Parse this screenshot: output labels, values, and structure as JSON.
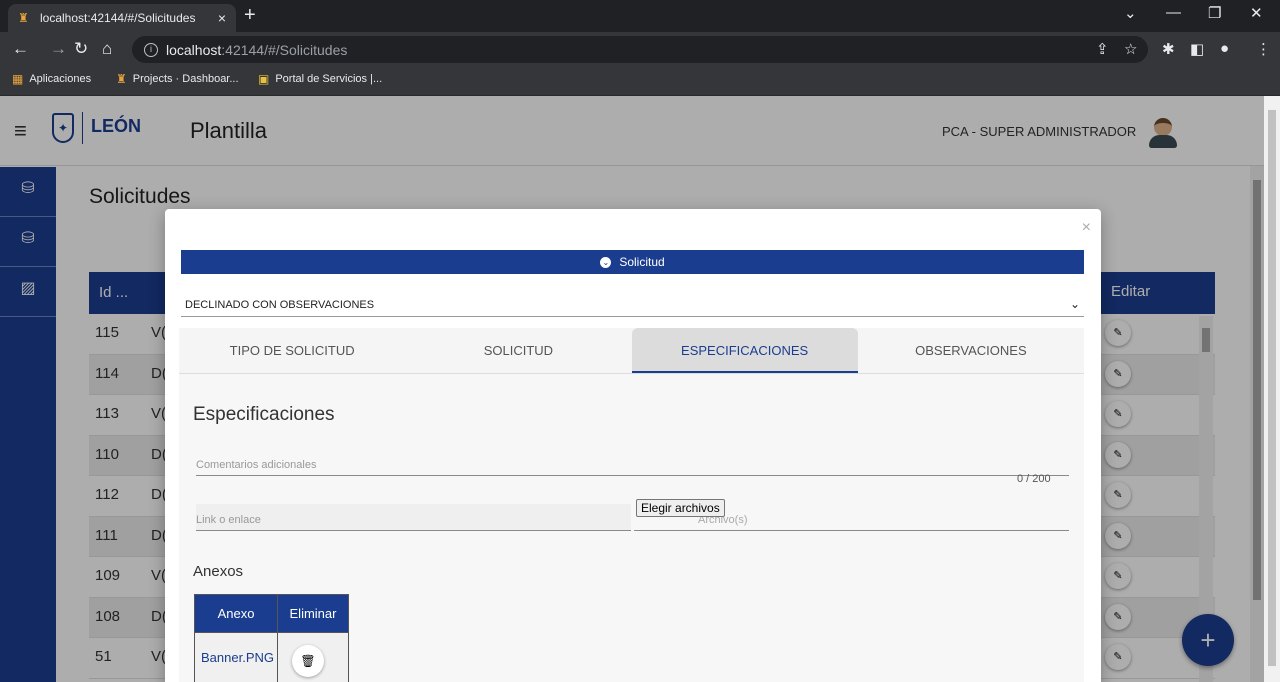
{
  "browser": {
    "tab_title": "localhost:42144/#/Solicitudes",
    "tab_close": "×",
    "new_tab": "+",
    "url_host": "localhost",
    "url_rest": ":42144/#/Solicitudes",
    "bookmarks": [
      {
        "label": "Aplicaciones"
      },
      {
        "label": "Projects · Dashboar..."
      },
      {
        "label": "Portal de Servicios |..."
      }
    ]
  },
  "app": {
    "logo_text": "LEÓN",
    "title": "Plantilla",
    "user_role": "PCA - SUPER ADMINISTRADOR",
    "page_title": "Solicitudes",
    "accent": "#1b3d8f"
  },
  "table": {
    "col_id": "Id ...",
    "col_edit": "Editar",
    "rows": [
      {
        "id": "115",
        "c2": "V("
      },
      {
        "id": "114",
        "c2": "D("
      },
      {
        "id": "113",
        "c2": "V("
      },
      {
        "id": "110",
        "c2": "D("
      },
      {
        "id": "112",
        "c2": "D("
      },
      {
        "id": "111",
        "c2": "D("
      },
      {
        "id": "109",
        "c2": "V("
      },
      {
        "id": "108",
        "c2": "D("
      },
      {
        "id": "51",
        "c2": "V("
      }
    ]
  },
  "modal": {
    "close": "×",
    "banner": "Solicitud",
    "status": "DECLINADO CON OBSERVACIONES",
    "tabs": [
      "TIPO DE SOLICITUD",
      "SOLICITUD",
      "ESPECIFICACIONES",
      "OBSERVACIONES"
    ],
    "active_tab": 2,
    "section_title": "Especificaciones",
    "comments_placeholder": "Comentarios adicionales",
    "counter": "0 / 200",
    "link_placeholder": "Link o enlace",
    "file_button": "Elegir archivos",
    "file_placeholder": "Archivo(s)",
    "anexos_title": "Anexos",
    "anexos_headers": [
      "Anexo",
      "Eliminar"
    ],
    "anexos": [
      {
        "name": "Banner.PNG"
      }
    ]
  },
  "fab_label": "+"
}
